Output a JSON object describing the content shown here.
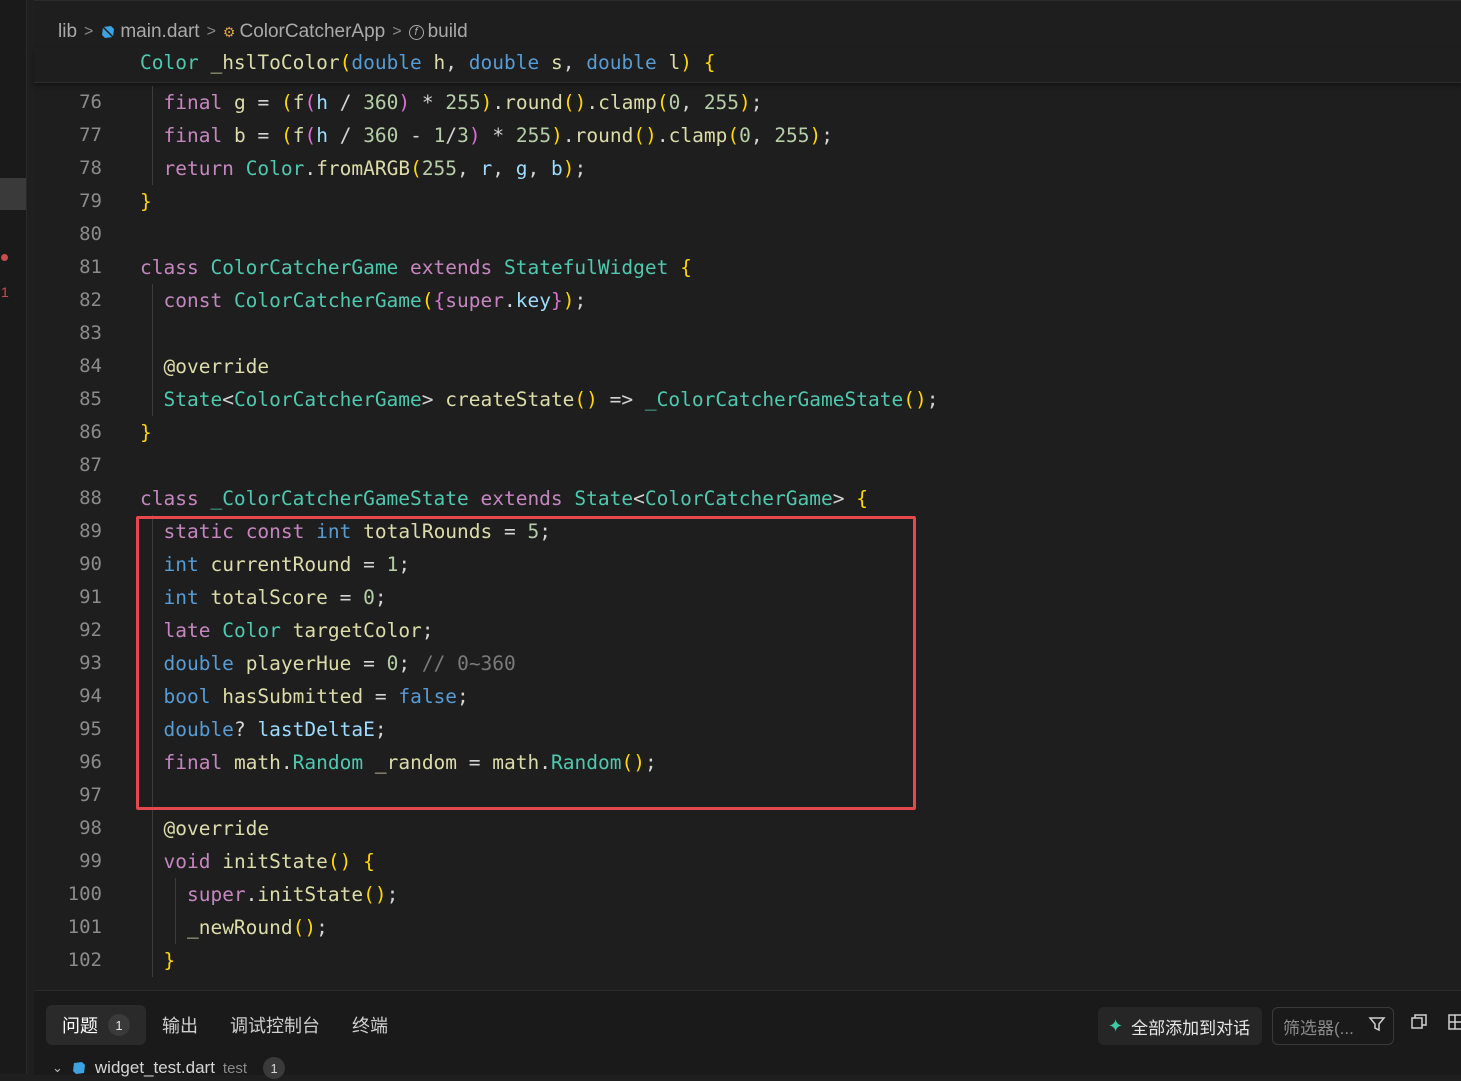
{
  "breadcrumb": {
    "root": "lib",
    "file": "main.dart",
    "class": "ColorCatcherApp",
    "method": "build"
  },
  "sticky": "Color _hslToColor(double h, double s, double l) {",
  "lines": [
    {
      "n": "76",
      "t": "  final g = (f(h / 360) * 255).round().clamp(0, 255);"
    },
    {
      "n": "77",
      "t": "  final b = (f(h / 360 - 1/3) * 255).round().clamp(0, 255);"
    },
    {
      "n": "78",
      "t": "  return Color.fromARGB(255, r, g, b);"
    },
    {
      "n": "79",
      "t": "}"
    },
    {
      "n": "80",
      "t": ""
    },
    {
      "n": "81",
      "t": "class ColorCatcherGame extends StatefulWidget {"
    },
    {
      "n": "82",
      "t": "  const ColorCatcherGame({super.key});"
    },
    {
      "n": "83",
      "t": ""
    },
    {
      "n": "84",
      "t": "  @override"
    },
    {
      "n": "85",
      "t": "  State<ColorCatcherGame> createState() => _ColorCatcherGameState();"
    },
    {
      "n": "86",
      "t": "}"
    },
    {
      "n": "87",
      "t": ""
    },
    {
      "n": "88",
      "t": "class _ColorCatcherGameState extends State<ColorCatcherGame> {"
    },
    {
      "n": "89",
      "t": "  static const int totalRounds = 5;"
    },
    {
      "n": "90",
      "t": "  int currentRound = 1;"
    },
    {
      "n": "91",
      "t": "  int totalScore = 0;"
    },
    {
      "n": "92",
      "t": "  late Color targetColor;"
    },
    {
      "n": "93",
      "t": "  double playerHue = 0; // 0~360"
    },
    {
      "n": "94",
      "t": "  bool hasSubmitted = false;"
    },
    {
      "n": "95",
      "t": "  double? lastDeltaE;"
    },
    {
      "n": "96",
      "t": "  final math.Random _random = math.Random();"
    },
    {
      "n": "97",
      "t": ""
    },
    {
      "n": "98",
      "t": "  @override"
    },
    {
      "n": "99",
      "t": "  void initState() {"
    },
    {
      "n": "100",
      "t": "    super.initState();"
    },
    {
      "n": "101",
      "t": "    _newRound();"
    },
    {
      "n": "102",
      "t": "  }"
    }
  ],
  "panel": {
    "tabs": [
      {
        "label": "问题",
        "badge": "1"
      },
      {
        "label": "输出"
      },
      {
        "label": "调试控制台"
      },
      {
        "label": "终端"
      }
    ],
    "add_to_chat": "全部添加到对话",
    "filter_placeholder": "筛选器(...",
    "problem_file": "widget_test.dart",
    "problem_dir": "test",
    "problem_count": "1"
  },
  "colors": {
    "highlight_box": "#e5484d",
    "keyword": "#c586c0",
    "type": "#4ec9b0",
    "function": "#dcdcaa",
    "variable": "#9cdcfe",
    "number": "#b5cea8"
  }
}
